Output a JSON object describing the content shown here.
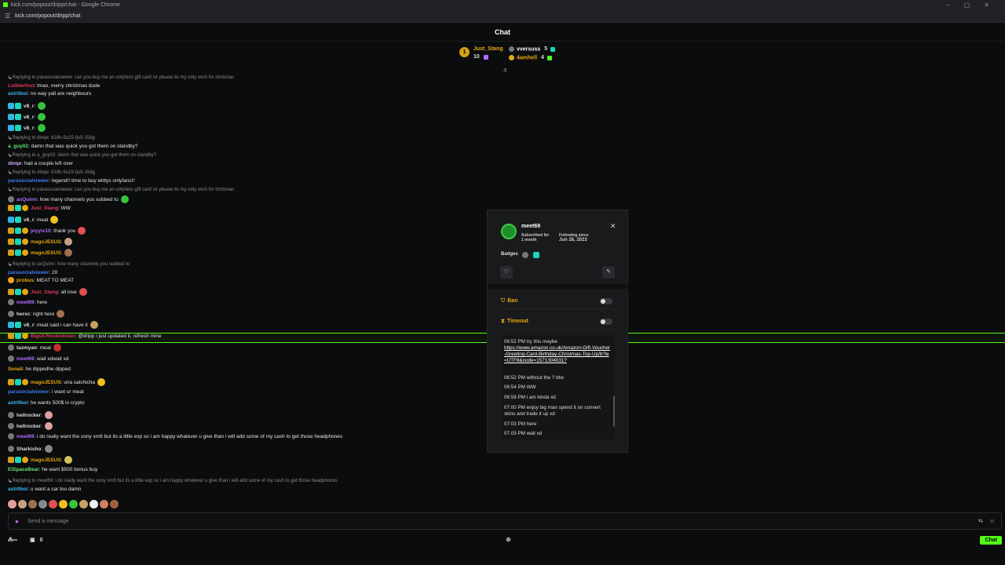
{
  "window": {
    "title": "kick.com/popout/dripp/chat - Google Chrome",
    "url": "kick.com/popout/dripp/chat"
  },
  "header": {
    "title": "Chat"
  },
  "leaders": [
    {
      "rank": "1",
      "name": "Just_Stang",
      "count": "10",
      "color": "#e5a80e"
    },
    {
      "name": "vversuss",
      "count": "5",
      "color": "#ffffff"
    },
    {
      "name": "4amhell",
      "count": "4",
      "color": "#e5a80e"
    }
  ],
  "messages": [
    {
      "reply": "Replying to parasocialviewer: can you buy me an onlyfans gift card sir please its my only wish for chrismas",
      "user": "Luthierfest",
      "ucolor": "#e23a5c",
      "text": ": lmao, merry christmas dude",
      "icons": []
    },
    {
      "user": "astr0boi",
      "ucolor": "#39b7f0",
      "text": ": no way yall are neighbours",
      "icons": []
    },
    {
      "user": "v8_r",
      "ucolor": "#ddd",
      "text": ": ",
      "icons": [
        "sub",
        "cyan"
      ],
      "emote": "#35c53c"
    },
    {
      "user": "v8_r",
      "ucolor": "#ddd",
      "text": ": ",
      "icons": [
        "sub",
        "cyan"
      ],
      "emote": "#35c53c"
    },
    {
      "user": "v8_r",
      "ucolor": "#ddd",
      "text": ": ",
      "icons": [
        "sub",
        "cyan"
      ],
      "emote": "#35c53c"
    },
    {
      "reply": "Replying to dinqe: 818h-5u15-fju5-15dg",
      "user": "a_guy02",
      "ucolor": "#5ce66e",
      "text": ": damn that was quick you got them on standby?",
      "icons": []
    },
    {
      "reply": "Replying to a_guy02: damn that was quick you got them on standby?",
      "user": "dinqe",
      "ucolor": "#d8a8ff",
      "text": ": had a couple left over",
      "icons": []
    },
    {
      "reply": "Replying to dinqe: 818h-5u15-fju5-15dg",
      "user": "parasocialviewer",
      "ucolor": "#3d7cf0",
      "text": ": legend!! time to buy ekttys onlyfans!!",
      "icons": []
    },
    {
      "reply": "Replying to parasocialviewer: can you buy me an onlyfans gift card sir please its my only wish for chrismas",
      "user": "axQuinn",
      "ucolor": "#b06cff",
      "text": ": how many channels you subbed to",
      "icons": [
        "gray"
      ],
      "emote": "#35c53c"
    },
    {
      "user": "Just_Stang",
      "ucolor": "#e23a5c",
      "text": ": WW",
      "icons": [
        "crown",
        "cyan",
        "gold"
      ]
    },
    {
      "user": "v8_r",
      "ucolor": "#ddd",
      "text": ": meat",
      "icons": [
        "sub",
        "cyan"
      ],
      "emote": "#f0c020"
    },
    {
      "user": "joyyix10",
      "ucolor": "#b06cff",
      "text": ": thank you",
      "icons": [
        "crown",
        "cyan",
        "gold"
      ],
      "emote": "#e05050"
    },
    {
      "user": "magoJESUS",
      "ucolor": "#e5a80e",
      "text": ":",
      "icons": [
        "crown",
        "cyan",
        "gold"
      ],
      "emote": "#c8a080"
    },
    {
      "user": "magoJESUS",
      "ucolor": "#e5a80e",
      "text": ":",
      "icons": [
        "crown",
        "cyan",
        "gold"
      ],
      "emote": "#a07050"
    },
    {
      "reply": "Replying to axQuinn: how many channels you subbed to",
      "user": "parasocialviewer",
      "ucolor": "#3d7cf0",
      "text": ": 20",
      "icons": [],
      "remote": "#35c53c"
    },
    {
      "user": "probus",
      "ucolor": "#e5a80e",
      "text": ": MEAT TO MEAT",
      "icons": [
        "gold"
      ]
    },
    {
      "user": "Just_Stang",
      "ucolor": "#e23a5c",
      "text": ": all love",
      "icons": [
        "crown",
        "cyan",
        "gold"
      ],
      "emote": "#e05050"
    },
    {
      "user": "meet69",
      "ucolor": "#b06cff",
      "text": ": here",
      "icons": [
        "gray"
      ]
    },
    {
      "user": "herxc",
      "ucolor": "#ddd",
      "text": ": right here",
      "icons": [
        "gray"
      ],
      "emote": "#a07050"
    },
    {
      "user": "v8_r",
      "ucolor": "#ddd",
      "text": ": meat said i can have it",
      "icons": [
        "sub",
        "cyan"
      ],
      "emote": "#c8a060"
    },
    {
      "user": "BigOl.Rocklobster",
      "ucolor": "#e23a5c",
      "text": ": @dripp i just updated it, refresh mine",
      "icons": [
        "crown",
        "cyan",
        "gold"
      ]
    },
    {
      "user": "tazmyan",
      "ucolor": "#ddd",
      "text": ": meat",
      "icons": [
        "gray"
      ],
      "emote": "#c03030"
    },
    {
      "user": "meet69",
      "ucolor": "#b06cff",
      "text": ": wait xdwait xd",
      "icons": [
        "gray"
      ]
    },
    {
      "user": "Senali",
      "ucolor": "#e5a80e",
      "text": ": he dippedhe dipped",
      "icons": []
    },
    {
      "user": "magoJESUS",
      "ucolor": "#e5a80e",
      "text": ": una salchicha",
      "icons": [
        "crown",
        "cyan",
        "gold"
      ],
      "emote": "#f0c020"
    },
    {
      "user": "parasocialviewer",
      "ucolor": "#3d7cf0",
      "text": ": i want ur meat",
      "icons": []
    },
    {
      "user": "astr0boi",
      "ucolor": "#39b7f0",
      "text": ": he wants 500$ in crypto",
      "icons": []
    },
    {
      "user": "hellrocker",
      "ucolor": "#ddd",
      "text": ":",
      "icons": [
        "gray"
      ],
      "emote": "#e0a0a0"
    },
    {
      "user": "hellrocker",
      "ucolor": "#ddd",
      "text": ":",
      "icons": [
        "gray"
      ],
      "emote": "#e0a0a0"
    },
    {
      "user": "meet69",
      "ucolor": "#b06cff",
      "text": ": i do really want the sony xm6 but its a little exp so i am happy whatever u give than i will add some of my cash to get those headphones",
      "icons": [
        "gray"
      ]
    },
    {
      "user": "Sharkisho",
      "ucolor": "#ddd",
      "text": ":",
      "icons": [
        "gray"
      ],
      "emote": "#888"
    },
    {
      "user": "magoJESUS",
      "ucolor": "#e5a80e",
      "text": ":",
      "icons": [
        "crown",
        "cyan",
        "gold"
      ],
      "emote": "#d0c060"
    },
    {
      "user": "ElSpaceBear",
      "ucolor": "#5ce66e",
      "text": ": he want $500 bonus buy",
      "icons": []
    },
    {
      "reply": "Replying to meet69: i do really want the sony xm6 but its a little exp so i am happy whatever u give than i will add some of my cash to get those headphones",
      "user": "astr0boi",
      "ucolor": "#39b7f0",
      "text": ": u want a car too damn",
      "icons": []
    }
  ],
  "modal": {
    "username": "meet69",
    "subscribed_label": "Subscribed for",
    "subscribed_value": "1 month",
    "following_label": "Following since",
    "following_value": "Jun 28, 2023",
    "badges_label": "Badges",
    "ban_label": "Ban",
    "timeout_label": "Timeout",
    "history": [
      {
        "time": "06:52 PM",
        "text": "try this maybe"
      },
      {
        "link": "https://www.amazon.co.uk/Amazon-Gift-Voucher-Greeting-Card-Birthday-Christmas-Top-Up/b?ie=UTF8&node=1571304031?"
      },
      {
        "time": "06:52 PM",
        "text": "without the ? btw"
      },
      {
        "time": "06:54 PM",
        "text": "WW"
      },
      {
        "time": "06:59 PM",
        "text": "i am kinda xd"
      },
      {
        "time": "07:00 PM",
        "text": "enjoy big man spend it on convert skins and trade it up xd"
      },
      {
        "time": "07:03 PM",
        "text": "here"
      },
      {
        "time": "07:03 PM",
        "text": "wait xd"
      }
    ]
  },
  "composer": {
    "placeholder": "Send a message"
  },
  "footer": {
    "points": "0",
    "chat_label": "Chat"
  },
  "colors": {
    "accent": "#53fc18"
  }
}
